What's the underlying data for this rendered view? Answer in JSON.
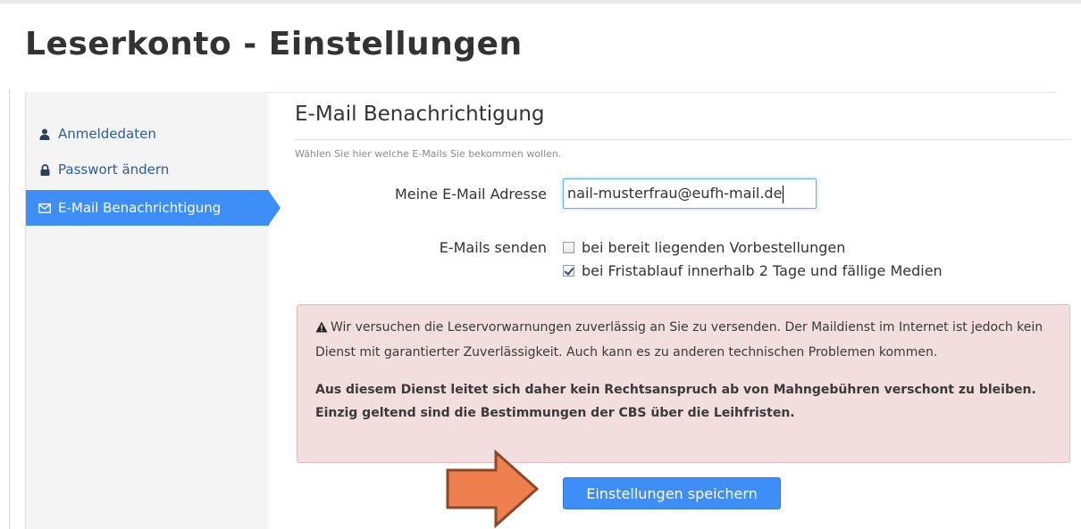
{
  "page": {
    "title": "Leserkonto - Einstellungen"
  },
  "sidebar": {
    "items": [
      {
        "label": "Anmeldedaten",
        "icon": "user-icon",
        "active": false
      },
      {
        "label": "Passwort ändern",
        "icon": "lock-icon",
        "active": false
      },
      {
        "label": "E-Mail Benachrichtigung",
        "icon": "envelope-icon",
        "active": true
      }
    ]
  },
  "main": {
    "section_title": "E-Mail Benachrichtigung",
    "section_help": "Wählen Sie hier welche E-Mails Sie bekommen wollen.",
    "email_label": "Meine E-Mail Adresse",
    "email_value": "nail-musterfrau@eufh-mail.de",
    "send_label": "E-Mails senden",
    "options": [
      {
        "label": "bei bereit liegenden Vorbestellungen",
        "checked": false
      },
      {
        "label": "bei Fristablauf innerhalb 2 Tage und fällige Medien",
        "checked": true
      }
    ],
    "alert": {
      "text": "Wir versuchen die Leservorwarnungen zuverlässig an Sie zu versenden. Der Maildienst im Internet ist jedoch kein Dienst mit garantierter Zuverlässigkeit. Auch kann es zu anderen technischen Problemen kommen.",
      "bold_text": "Aus diesem Dienst leitet sich daher kein Rechtsanspruch ab von Mahngebühren verschont zu bleiben. Einzig geltend sind die Bestimmungen der CBS über die Leihfristen.",
      "icon": "warning-icon"
    },
    "save_label": "Einstellungen speichern"
  },
  "colors": {
    "accent": "#3e8ef7",
    "alert_bg": "#f2dede",
    "annotation_arrow": "#f07f4f"
  }
}
